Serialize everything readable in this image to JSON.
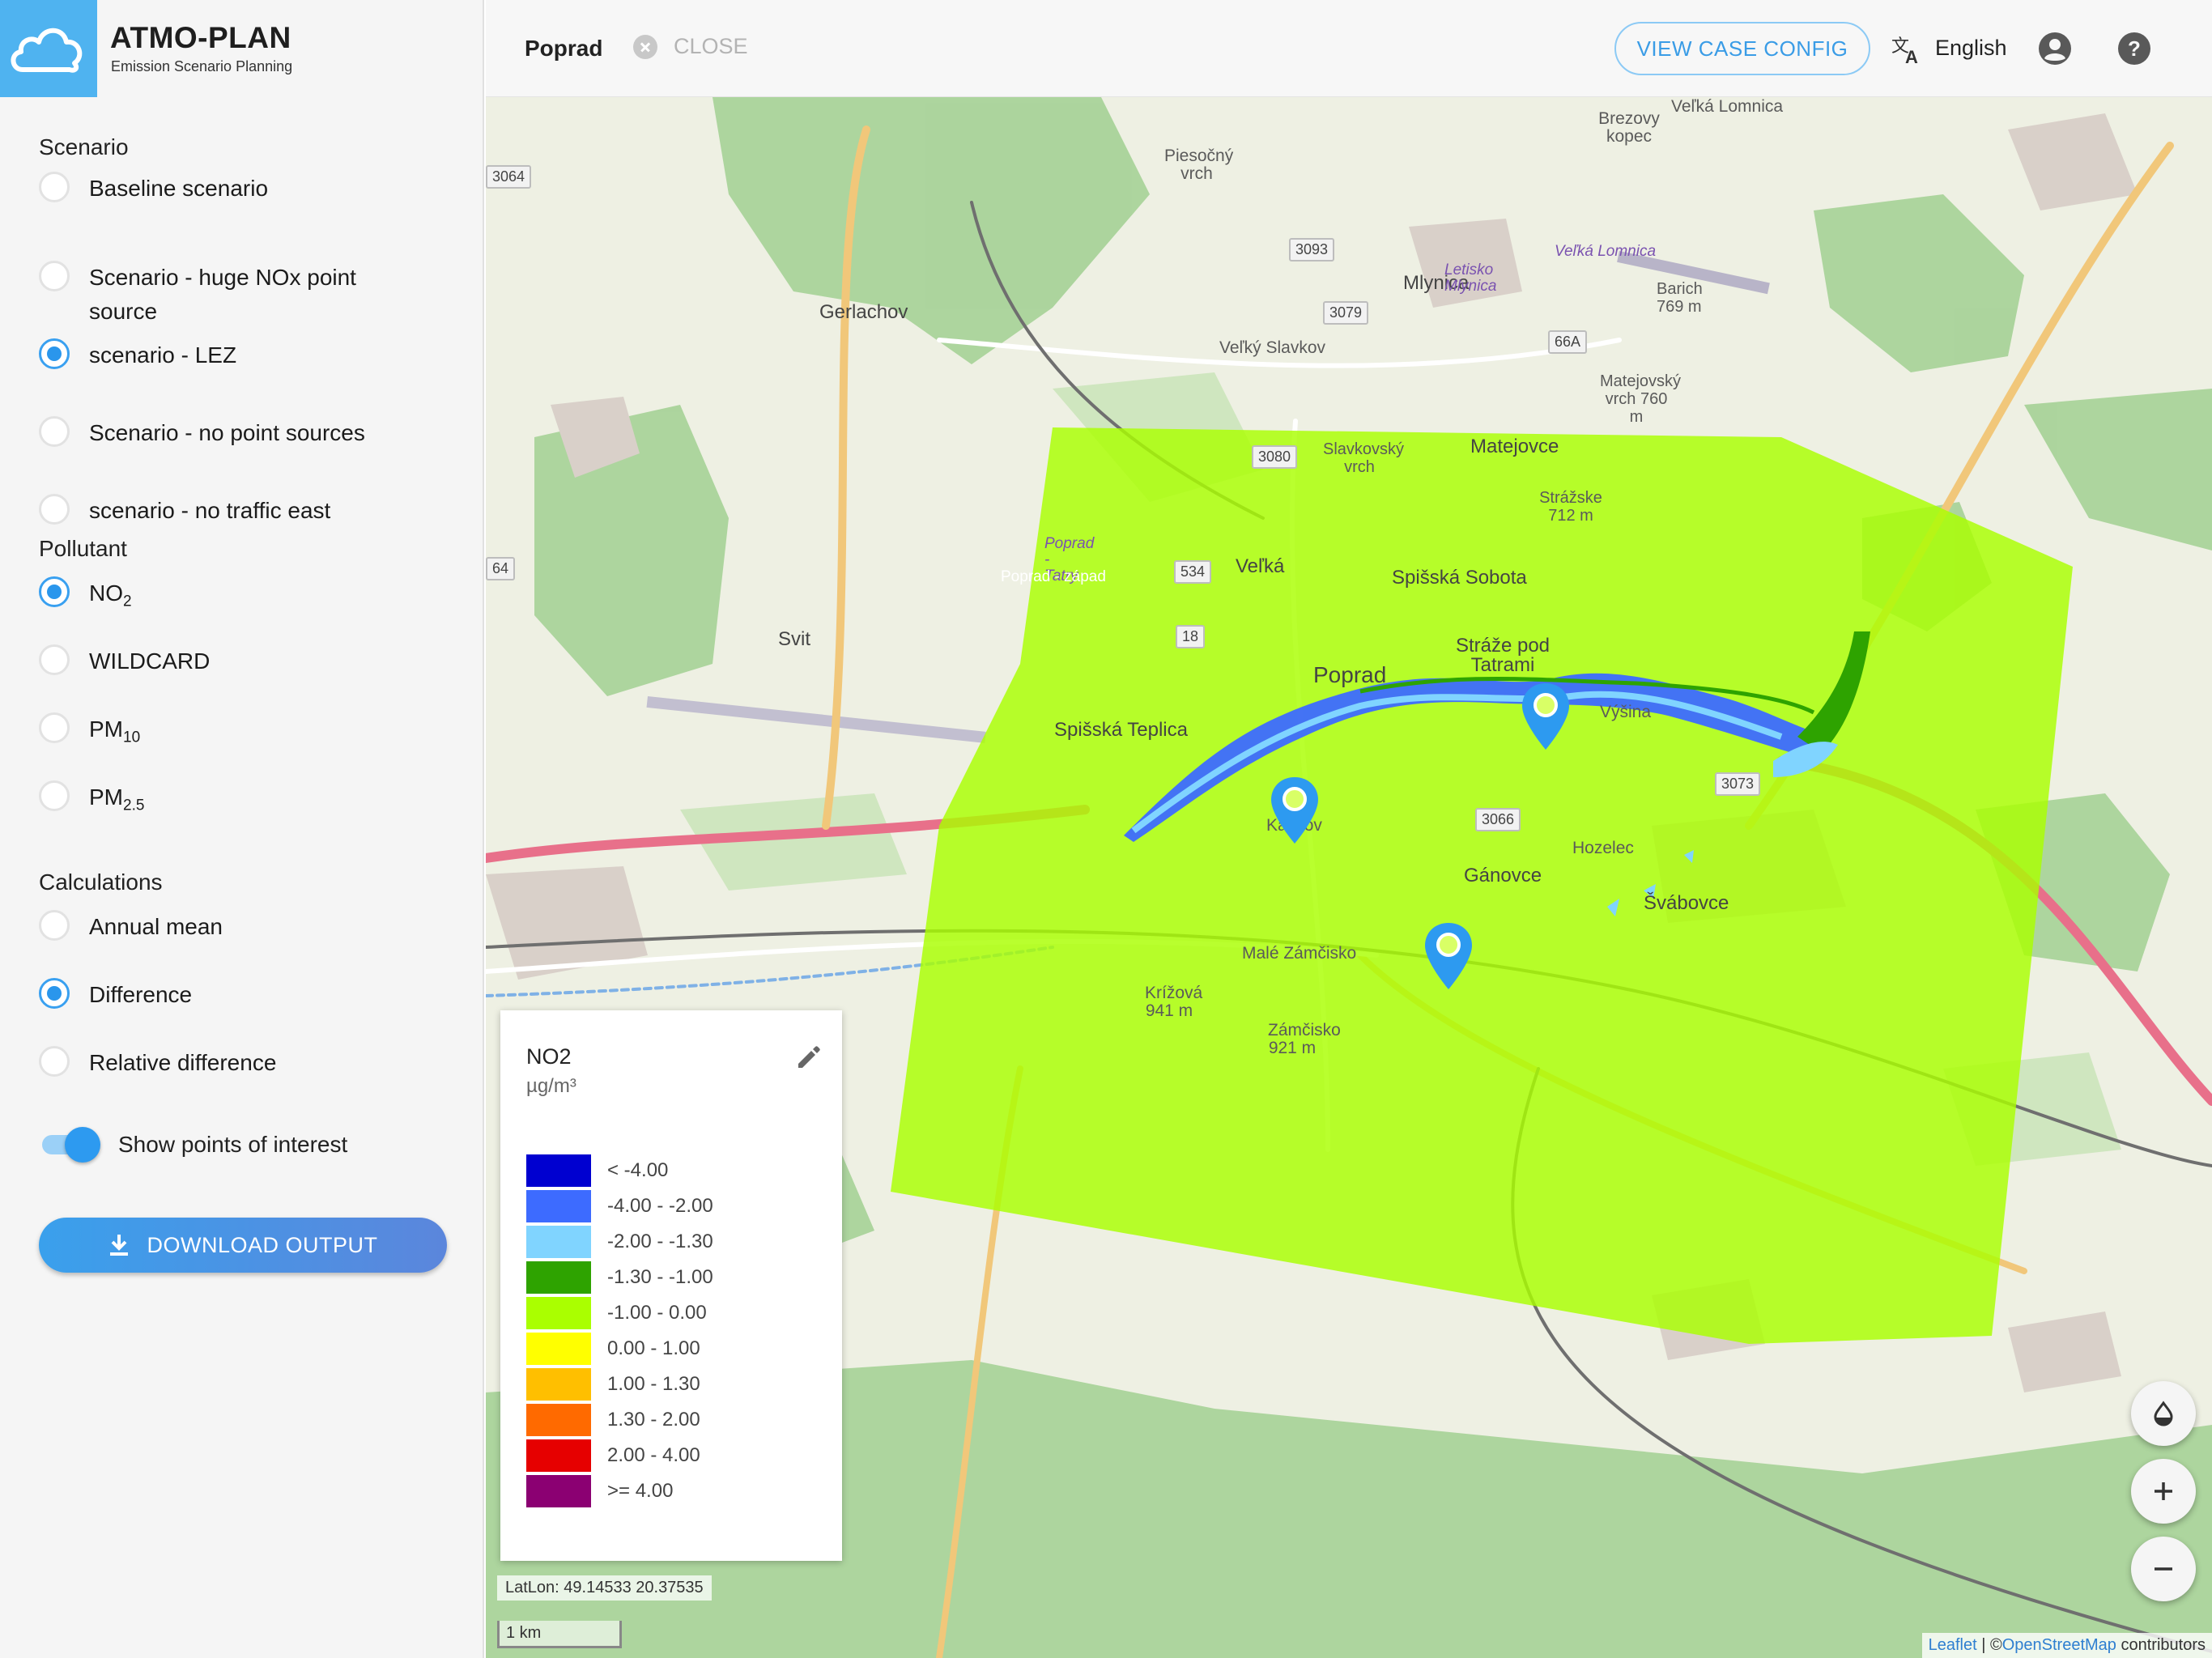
{
  "brand": {
    "title": "ATMO-PLAN",
    "subtitle": "Emission Scenario Planning"
  },
  "topbar": {
    "place": "Poprad",
    "close_label": "CLOSE",
    "view_config_label": "VIEW CASE CONFIG",
    "language": "English"
  },
  "sidebar": {
    "scenario_title": "Scenario",
    "scenarios": [
      {
        "label": "Baseline scenario",
        "selected": false
      },
      {
        "label": "Scenario - huge NOx point source",
        "selected": false
      },
      {
        "label": "scenario - LEZ",
        "selected": true
      },
      {
        "label": "Scenario - no point sources",
        "selected": false
      },
      {
        "label": "scenario - no traffic east",
        "selected": false
      }
    ],
    "pollutant_title": "Pollutant",
    "pollutants": [
      {
        "base": "NO",
        "sub": "2",
        "selected": true
      },
      {
        "base": "WILDCARD",
        "sub": "",
        "selected": false
      },
      {
        "base": "PM",
        "sub": "10",
        "selected": false
      },
      {
        "base": "PM",
        "sub": "2.5",
        "selected": false
      }
    ],
    "calculations_title": "Calculations",
    "calculations": [
      {
        "label": "Annual mean",
        "selected": false
      },
      {
        "label": "Difference",
        "selected": true
      },
      {
        "label": "Relative difference",
        "selected": false
      }
    ],
    "poi_toggle_label": "Show points of interest",
    "poi_toggle_on": true,
    "download_label": "DOWNLOAD OUTPUT"
  },
  "legend": {
    "title": "NO2",
    "unit": "µg/m³",
    "classes": [
      {
        "label": "< -4.00",
        "color": "#0000d0"
      },
      {
        "label": "-4.00 - -2.00",
        "color": "#3d6bff"
      },
      {
        "label": "-2.00 - -1.30",
        "color": "#80d4ff"
      },
      {
        "label": "-1.30 - -1.00",
        "color": "#2ea300"
      },
      {
        "label": "-1.00 - 0.00",
        "color": "#aaff00"
      },
      {
        "label": "0.00 - 1.00",
        "color": "#ffff00"
      },
      {
        "label": "1.00 - 1.30",
        "color": "#ffbf00"
      },
      {
        "label": "1.30 - 2.00",
        "color": "#ff6a00"
      },
      {
        "label": "2.00 - 4.00",
        "color": "#e60000"
      },
      {
        "label": ">= 4.00",
        "color": "#8b0072"
      }
    ]
  },
  "map": {
    "coords_label": "LatLon: 49.14533 20.37535",
    "scale_label": "1 km",
    "attribution_leaflet": "Leaflet",
    "attribution_sep": " | ©",
    "attribution_osm": "OpenStreetMap",
    "attribution_tail": " contributors",
    "place_labels": [
      "Veľká Lomnica",
      "Piesočný vrch",
      "Brezovy kopec",
      "Gerlachov",
      "Mlynica",
      "Letisko Mlynica",
      "Veľká Lomnica",
      "Barich 769 m",
      "Veľký Slavkov",
      "Matejovský vrch 760 m",
      "Slavkovský vrch",
      "Matejovce",
      "Strážske 712 m",
      "Poprad - Tatry",
      "Poprad - západ",
      "Veľká",
      "Spišská Sobota",
      "Svit",
      "Stráže pod Tatrami",
      "Poprad",
      "Spišská Teplica",
      "Výšina",
      "Kalinov",
      "Gánovce",
      "Hozelec",
      "Švábovce",
      "Malé Zámčisko",
      "Krížová 941 m",
      "Zámčisko 921 m"
    ],
    "road_badges": [
      "3064",
      "3093",
      "3079",
      "66A",
      "3080",
      "534",
      "18",
      "3073",
      "3066",
      "64"
    ],
    "markers": 3
  }
}
